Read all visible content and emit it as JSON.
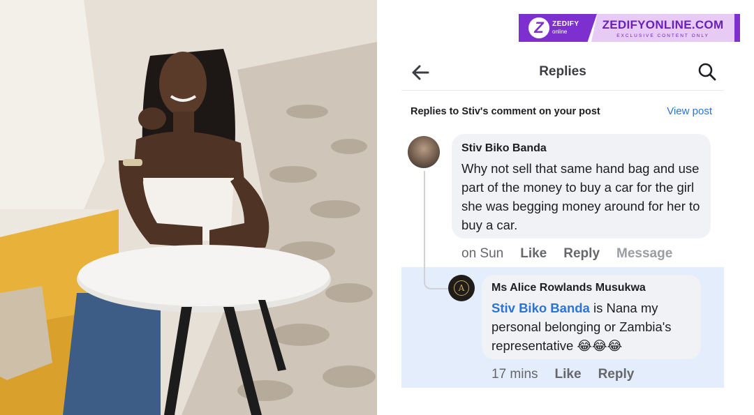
{
  "brand": {
    "logo_mark": "Z",
    "logo_word": "ZEDIFY",
    "logo_sub": "online",
    "site": "ZEDIFYONLINE.COM",
    "tagline": "EXCLUSIVE CONTENT ONLY",
    "color": "#7d2fd0"
  },
  "header": {
    "title": "Replies",
    "back_icon": "arrow-left-icon",
    "search_icon": "search-icon"
  },
  "context": {
    "text": "Replies to Stiv's comment on your post",
    "view_post": "View post"
  },
  "comment": {
    "author": "Stiv Biko Banda",
    "text": "Why not sell that same hand bag and use part of the money to buy a car for the girl she was begging money around for her to buy a car.",
    "time": "on Sun",
    "actions": [
      "Like",
      "Reply",
      "Message"
    ]
  },
  "reply": {
    "author": "Ms Alice Rowlands Musukwa",
    "mention": "Stiv Biko Banda",
    "text": " is Nana my personal belonging or Zambia's representative 😂😂😂",
    "time": "17 mins",
    "actions": [
      "Like",
      "Reply"
    ],
    "highlight_color": "#e3edfb"
  }
}
